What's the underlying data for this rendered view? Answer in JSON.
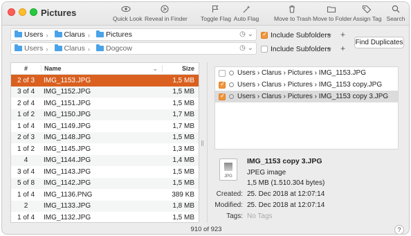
{
  "window": {
    "title": "Pictures"
  },
  "toolbar": [
    {
      "label": "Quick Look",
      "icon": "eye-icon"
    },
    {
      "label": "Reveal in Finder",
      "icon": "reveal-icon"
    },
    {
      "label": "Toggle Flag",
      "icon": "flag-icon"
    },
    {
      "label": "Auto Flag",
      "icon": "sparkle-icon"
    },
    {
      "label": "Move to Trash",
      "icon": "trash-icon"
    },
    {
      "label": "Move to Folder",
      "icon": "folder-icon"
    },
    {
      "label": "Assign Tag",
      "icon": "tag-icon"
    },
    {
      "label": "Search",
      "icon": "search-icon"
    }
  ],
  "paths": [
    {
      "segments": [
        "Users",
        "Clarus",
        "Pictures"
      ],
      "include_subfolders": "Include Subfolders",
      "checked": true
    },
    {
      "segments": [
        "Users",
        "Clarus",
        "Dogcow"
      ],
      "include_subfolders": "Include Subfolders",
      "checked": false
    }
  ],
  "find_button": "Find Duplicates",
  "table": {
    "headers": {
      "num": "#",
      "name": "Name",
      "size": "Size"
    },
    "rows": [
      {
        "num": "2 of 3",
        "name": "IMG_1153.JPG",
        "size": "1,5 MB",
        "selected": true
      },
      {
        "num": "3 of 4",
        "name": "IMG_1152.JPG",
        "size": "1,5 MB"
      },
      {
        "num": "2 of 4",
        "name": "IMG_1151.JPG",
        "size": "1,5 MB"
      },
      {
        "num": "1 of 2",
        "name": "IMG_1150.JPG",
        "size": "1,7 MB"
      },
      {
        "num": "1 of 4",
        "name": "IMG_1149.JPG",
        "size": "1,7 MB"
      },
      {
        "num": "2 of 3",
        "name": "IMG_1148.JPG",
        "size": "1,5 MB"
      },
      {
        "num": "1 of 2",
        "name": "IMG_1145.JPG",
        "size": "1,3 MB"
      },
      {
        "num": "4",
        "name": "IMG_1144.JPG",
        "size": "1,4 MB"
      },
      {
        "num": "3 of 4",
        "name": "IMG_1143.JPG",
        "size": "1,5 MB"
      },
      {
        "num": "5 of 8",
        "name": "IMG_1142.JPG",
        "size": "1,5 MB"
      },
      {
        "num": "1 of 4",
        "name": "IMG_1136.PNG",
        "size": "389 KB"
      },
      {
        "num": "2",
        "name": "IMG_1133.JPG",
        "size": "1,8 MB"
      },
      {
        "num": "1 of 4",
        "name": "IMG_1132.JPG",
        "size": "1,5 MB"
      }
    ]
  },
  "duplicates": [
    {
      "path": "Users › Clarus › Pictures › IMG_1153.JPG",
      "checked": false,
      "highlight": false
    },
    {
      "path": "Users › Clarus › Pictures › IMG_1153 copy.JPG",
      "checked": true,
      "highlight": false
    },
    {
      "path": "Users › Clarus › Pictures › IMG_1153 copy 3.JPG",
      "checked": true,
      "highlight": true
    }
  ],
  "details": {
    "filename": "IMG_1153 copy 3.JPG",
    "kind": "JPEG image",
    "size": "1,5 MB (1.510.304 bytes)",
    "thumb_ext": "JPG",
    "created_label": "Created:",
    "created": "25. Dec 2018 at 12:07:14",
    "modified_label": "Modified:",
    "modified": "25. Dec 2018 at 12:07:14",
    "tags_label": "Tags:",
    "tags": "No Tags"
  },
  "status": {
    "count": "910 of 923",
    "help": "?"
  }
}
